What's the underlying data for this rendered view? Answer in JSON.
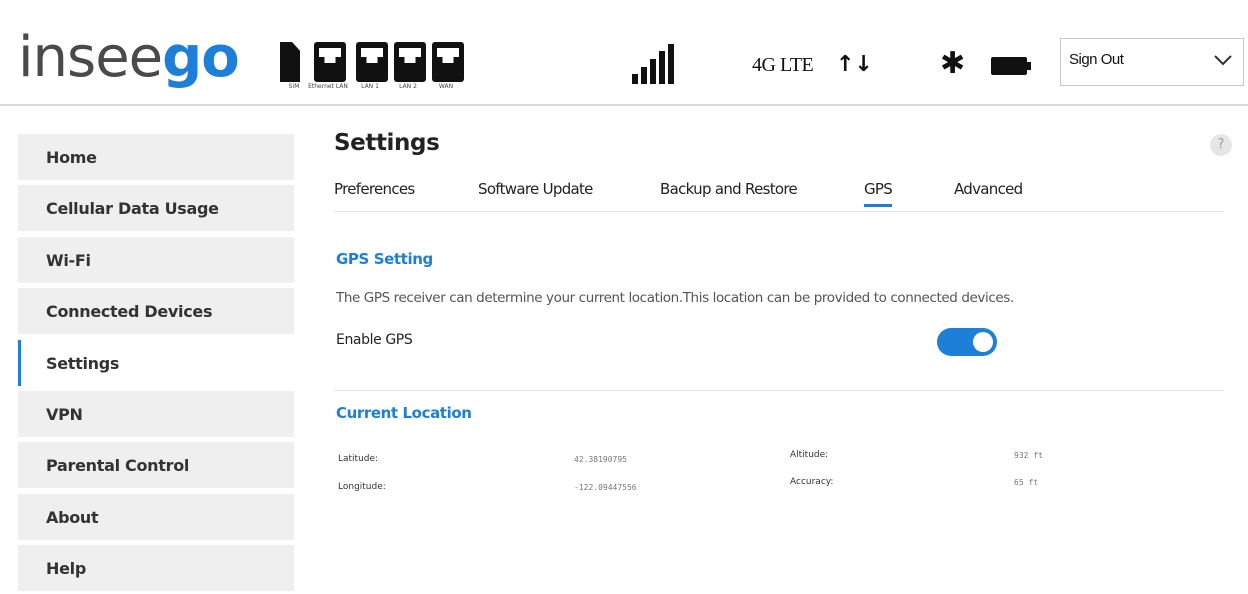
{
  "header": {
    "logo": {
      "part1": "insee",
      "part2": "go"
    },
    "ports": [
      {
        "label": "SIM",
        "icon": "sim-card-icon"
      },
      {
        "label": "Ethernet LAN",
        "icon": "ethernet-port-icon"
      },
      {
        "label": "LAN 1",
        "icon": "ethernet-port-icon"
      },
      {
        "label": "LAN 2",
        "icon": "ethernet-port-icon"
      },
      {
        "label": "WAN",
        "icon": "ethernet-port-icon"
      }
    ],
    "network_type": "4G LTE",
    "signout_label": "Sign Out"
  },
  "sidebar": {
    "items": [
      {
        "label": "Home"
      },
      {
        "label": "Cellular Data Usage"
      },
      {
        "label": "Wi-Fi"
      },
      {
        "label": "Connected Devices"
      },
      {
        "label": "Settings",
        "active": true
      },
      {
        "label": "VPN"
      },
      {
        "label": "Parental Control"
      },
      {
        "label": "About"
      },
      {
        "label": "Help"
      }
    ]
  },
  "main": {
    "title": "Settings",
    "help_glyph": "?",
    "tabs": [
      {
        "label": "Preferences"
      },
      {
        "label": "Software Update"
      },
      {
        "label": "Backup and Restore"
      },
      {
        "label": "GPS",
        "active": true
      },
      {
        "label": "Advanced"
      }
    ],
    "gps_setting_heading": "GPS Setting",
    "description": "The GPS receiver can determine your current location.This location can be provided to connected devices.",
    "enable_gps_label": "Enable GPS",
    "enable_gps_on": true,
    "current_location_heading": "Current Location",
    "location": {
      "latitude_label": "Latitude:",
      "latitude_value": "42.38190795",
      "longitude_label": "Longitude:",
      "longitude_value": "-122.09447556",
      "altitude_label": "Altitude:",
      "altitude_value": "932 ft",
      "accuracy_label": "Accuracy:",
      "accuracy_value": "65 ft"
    }
  },
  "colors": {
    "accent": "#1e7fd8",
    "sidebar_bg": "#efefef",
    "text": "#222222"
  }
}
